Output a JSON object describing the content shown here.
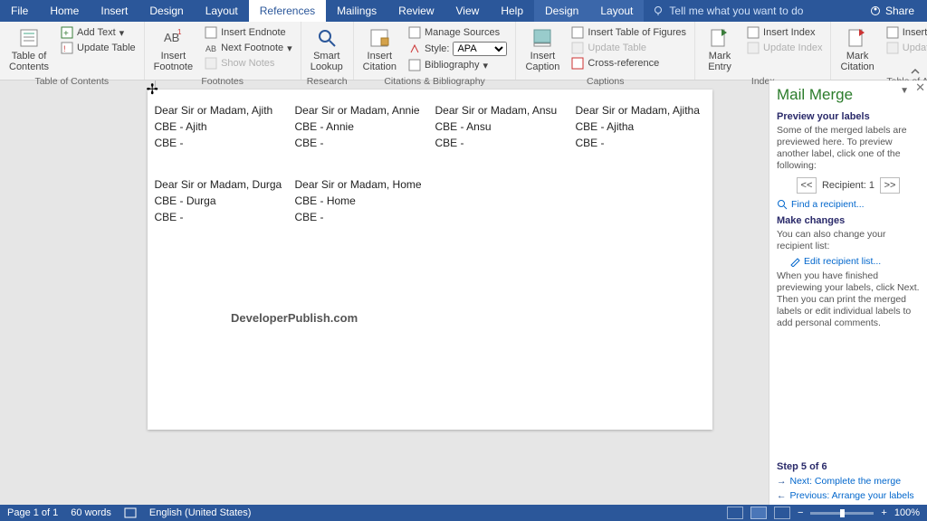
{
  "tabs": {
    "file": "File",
    "home": "Home",
    "insert": "Insert",
    "design": "Design",
    "layout": "Layout",
    "references": "References",
    "mailings": "Mailings",
    "review": "Review",
    "view": "View",
    "help": "Help",
    "design2": "Design",
    "layout2": "Layout",
    "tellme": "Tell me what you want to do",
    "share": "Share"
  },
  "ribbon": {
    "toc": {
      "big": "Table of\nContents",
      "add": "Add Text",
      "update": "Update Table",
      "group": "Table of Contents"
    },
    "fn": {
      "big": "Insert\nFootnote",
      "end": "Insert Endnote",
      "next": "Next Footnote",
      "show": "Show Notes",
      "group": "Footnotes"
    },
    "research": {
      "big": "Smart\nLookup",
      "group": "Research"
    },
    "cit": {
      "big": "Insert\nCitation",
      "manage": "Manage Sources",
      "style": "Style:",
      "apa": "APA",
      "bib": "Bibliography",
      "group": "Citations & Bibliography"
    },
    "cap": {
      "big": "Insert\nCaption",
      "table": "Insert Table of Figures",
      "update": "Update Table",
      "cross": "Cross-reference",
      "group": "Captions"
    },
    "idx": {
      "mark": "Mark\nEntry",
      "insert": "Insert Index",
      "update": "Update Index",
      "group": "Index"
    },
    "auth": {
      "mark": "Mark\nCitation",
      "insert": "Insert Table of Authorities",
      "update": "Update Table",
      "group": "Table of Authorities"
    }
  },
  "doc": {
    "labels": [
      {
        "greet": "Dear Sir or Madam, Ajith",
        "l2": "CBE -  Ajith",
        "l3": "CBE -"
      },
      {
        "greet": "Dear Sir or Madam, Annie",
        "l2": "CBE -  Annie",
        "l3": "CBE -"
      },
      {
        "greet": "Dear Sir or Madam, Ansu",
        "l2": "CBE -  Ansu",
        "l3": "CBE -"
      },
      {
        "greet": "Dear Sir or Madam, Ajitha",
        "l2": "CBE -  Ajitha",
        "l3": "CBE -"
      },
      {
        "greet": "Dear Sir or Madam, Durga",
        "l2": "CBE -  Durga",
        "l3": "CBE -"
      },
      {
        "greet": "Dear Sir or Madam, Home",
        "l2": "CBE -  Home",
        "l3": "CBE -"
      }
    ],
    "watermark": "DeveloperPublish.com"
  },
  "pane": {
    "title": "Mail Merge",
    "sec1": "Preview your labels",
    "body1": "Some of the merged labels are previewed here. To preview another label, click one of the following:",
    "recip_label": "Recipient: 1",
    "find": "Find a recipient...",
    "sec2": "Make changes",
    "body2": "You can also change your recipient list:",
    "edit": "Edit recipient list...",
    "body3": "When you have finished previewing your labels, click Next. Then you can print the merged labels or edit individual labels to add personal comments.",
    "step": "Step 5 of 6",
    "next": "Next: Complete the merge",
    "prev": "Previous: Arrange your labels"
  },
  "status": {
    "page": "Page 1 of 1",
    "words": "60 words",
    "lang": "English (United States)",
    "zoom": "100%"
  }
}
